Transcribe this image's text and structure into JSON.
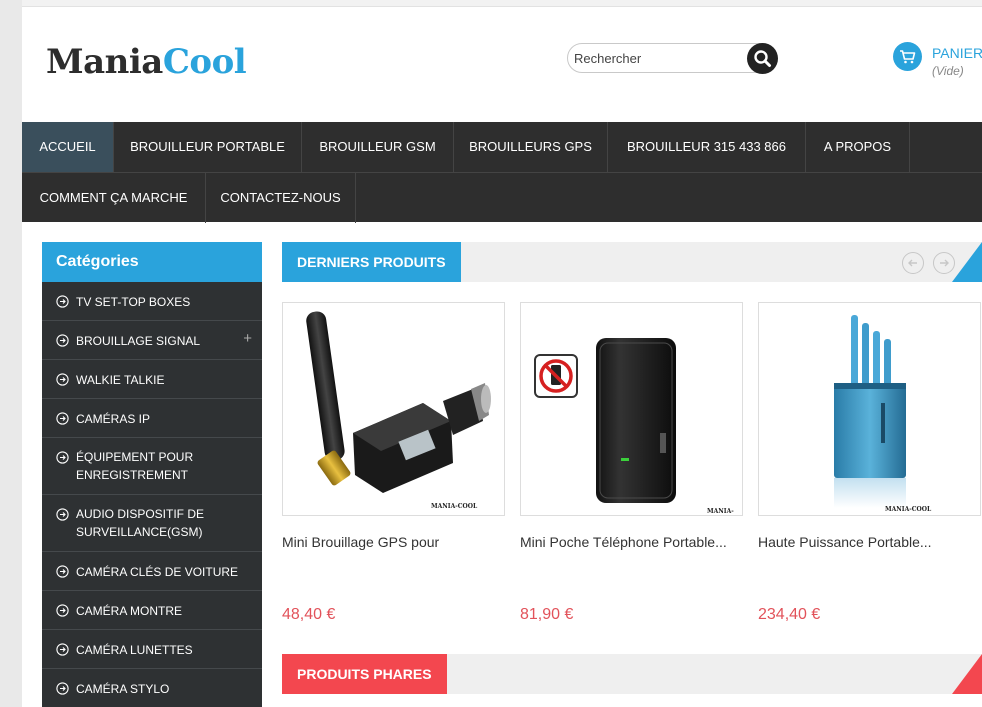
{
  "header": {
    "logo_part1": "Mania",
    "logo_part2": "Cool",
    "search_placeholder": "Rechercher",
    "cart_label": "PANIER",
    "cart_status": "(Vide)"
  },
  "nav": {
    "items": [
      "ACCUEIL",
      "BROUILLEUR PORTABLE",
      "BROUILLEUR GSM",
      "BROUILLEURS GPS",
      "BROUILLEUR 315 433 866",
      "A PROPOS",
      "COMMENT ÇA MARCHE",
      "CONTACTEZ-NOUS"
    ],
    "active": "ACCUEIL"
  },
  "sidebar": {
    "title": "Catégories",
    "items": [
      {
        "label": "TV SET-TOP BOXES"
      },
      {
        "label": "BROUILLAGE SIGNAL",
        "expand": "+"
      },
      {
        "label": "WALKIE TALKIE"
      },
      {
        "label": "CAMÉRAS IP"
      },
      {
        "label": "ÉQUIPEMENT POUR ENREGISTREMENT"
      },
      {
        "label": "AUDIO DISPOSITIF DE SURVEILLANCE(GSM)"
      },
      {
        "label": "CAMÉRA CLÉS DE VOITURE"
      },
      {
        "label": "CAMÉRA MONTRE"
      },
      {
        "label": "CAMÉRA LUNETTES"
      },
      {
        "label": "CAMÉRA STYLO"
      }
    ]
  },
  "sections": {
    "latest_title": "DERNIERS PRODUITS",
    "featured_title": "PRODUITS PHARES"
  },
  "products": [
    {
      "name": "Mini Brouillage GPS pour",
      "price": "48,40 €",
      "watermark": "MANIA-COOL"
    },
    {
      "name": "Mini Poche Téléphone Portable...",
      "price": "81,90 €",
      "watermark": "MANIA-COOL"
    },
    {
      "name": "Haute Puissance Portable...",
      "price": "234,40 €",
      "watermark": "MANIA-COOL"
    }
  ],
  "colors": {
    "accent": "#2aa3dc",
    "featured": "#f3474f",
    "price": "#e2525a",
    "nav_bg": "#2e2e2e",
    "active_nav": "#3a4f5c"
  }
}
